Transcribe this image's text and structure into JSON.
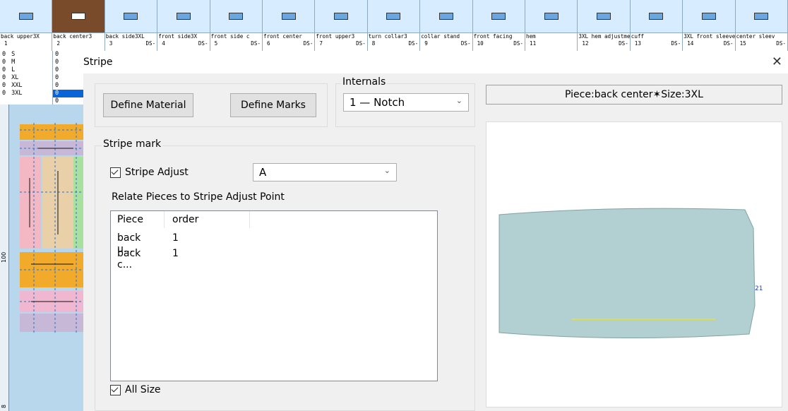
{
  "pieces": [
    {
      "caption": "back upper3X",
      "num": "1",
      "ds": ""
    },
    {
      "caption": "back center3",
      "num": "2",
      "ds": ""
    },
    {
      "caption": "back side3XL",
      "num": "3",
      "ds": "DS-"
    },
    {
      "caption": "front side3X",
      "num": "4",
      "ds": "DS-"
    },
    {
      "caption": "front side c",
      "num": "5",
      "ds": "DS-"
    },
    {
      "caption": "front center",
      "num": "6",
      "ds": "DS-"
    },
    {
      "caption": "front upper3",
      "num": "7",
      "ds": "DS-"
    },
    {
      "caption": "turn collar3",
      "num": "8",
      "ds": "DS-"
    },
    {
      "caption": "collar stand",
      "num": "9",
      "ds": "DS-"
    },
    {
      "caption": "front facing",
      "num": "10",
      "ds": "DS-"
    },
    {
      "caption": "hem",
      "num": "11",
      "ds": ""
    },
    {
      "caption": "3XL hem adjustme",
      "num": "12",
      "ds": "DS-"
    },
    {
      "caption": "cuff",
      "num": "13",
      "ds": "DS-"
    },
    {
      "caption": "3XL front sleeve",
      "num": "14",
      "ds": "DS-"
    },
    {
      "caption": "center sleev",
      "num": "15",
      "ds": "DS-"
    }
  ],
  "sizes": [
    {
      "qty": "0",
      "name": "S"
    },
    {
      "qty": "0",
      "name": "M"
    },
    {
      "qty": "0",
      "name": "L"
    },
    {
      "qty": "0",
      "name": "XL"
    },
    {
      "qty": "0",
      "name": "XXL"
    },
    {
      "qty": "0",
      "name": "3XL"
    }
  ],
  "sizes2": [
    "0",
    "0",
    "0",
    "0",
    "0",
    "0",
    "0"
  ],
  "ruler": {
    "mark_100": "100",
    "mark_bottom": "8"
  },
  "dialog": {
    "title": "Stripe",
    "close_glyph": "✕",
    "define_material": "Define Material",
    "define_marks": "Define Marks",
    "internals_label": "Internals",
    "internals_value": "1 — Notch",
    "stripe_mark_label": "Stripe mark",
    "stripe_adjust_label": "Stripe Adjust",
    "stripe_adjust_value": "A",
    "relate_label": "Relate Pieces to Stripe Adjust Point",
    "columns": [
      "Piece",
      "order"
    ],
    "rows": [
      {
        "piece": "back u...",
        "order": "1"
      },
      {
        "piece": "back c...",
        "order": "1"
      }
    ],
    "all_size_label": "All Size",
    "info_text": "Piece:back center✶Size:3XL",
    "point_label": "21",
    "dropdown_glyph": "⌵"
  },
  "colors": {
    "piece_fill": "#b2cfd1",
    "stripe_line": "#e6e233",
    "accent_sel": "#7a4b2a",
    "highlight": "#0a64d8"
  }
}
